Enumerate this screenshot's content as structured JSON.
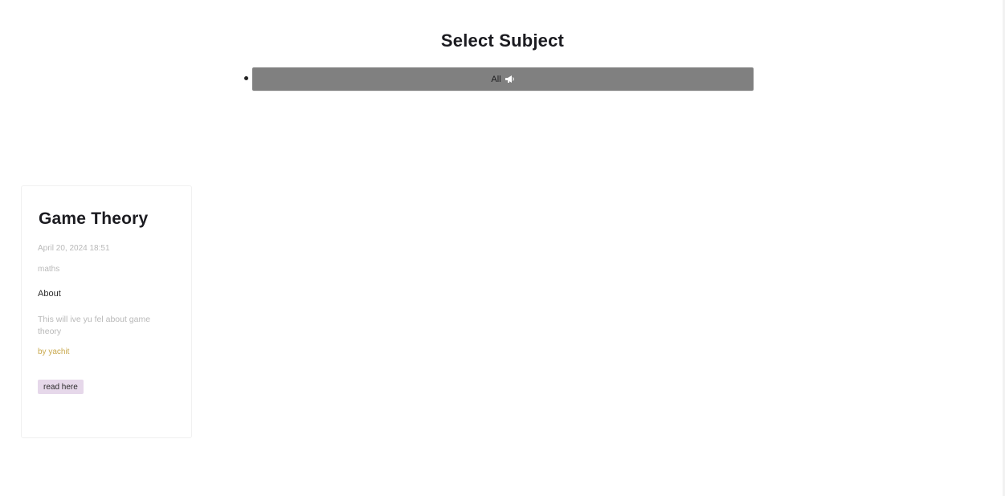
{
  "header": {
    "title": "Select Subject"
  },
  "subjects": {
    "items": [
      {
        "label": "All",
        "icon": "megaphone-icon"
      }
    ]
  },
  "card": {
    "title": "Game Theory",
    "date": "April 20, 2024 18:51",
    "subject": "maths",
    "about_label": "About",
    "description": "This will ive yu fel about game theory",
    "author": "by yachit",
    "button_label": "read here"
  },
  "colors": {
    "subject_button_bg": "#808080",
    "read_button_bg": "#e6d8ea",
    "author_text": "#c9a94e",
    "muted_text": "#b9b9b9"
  }
}
